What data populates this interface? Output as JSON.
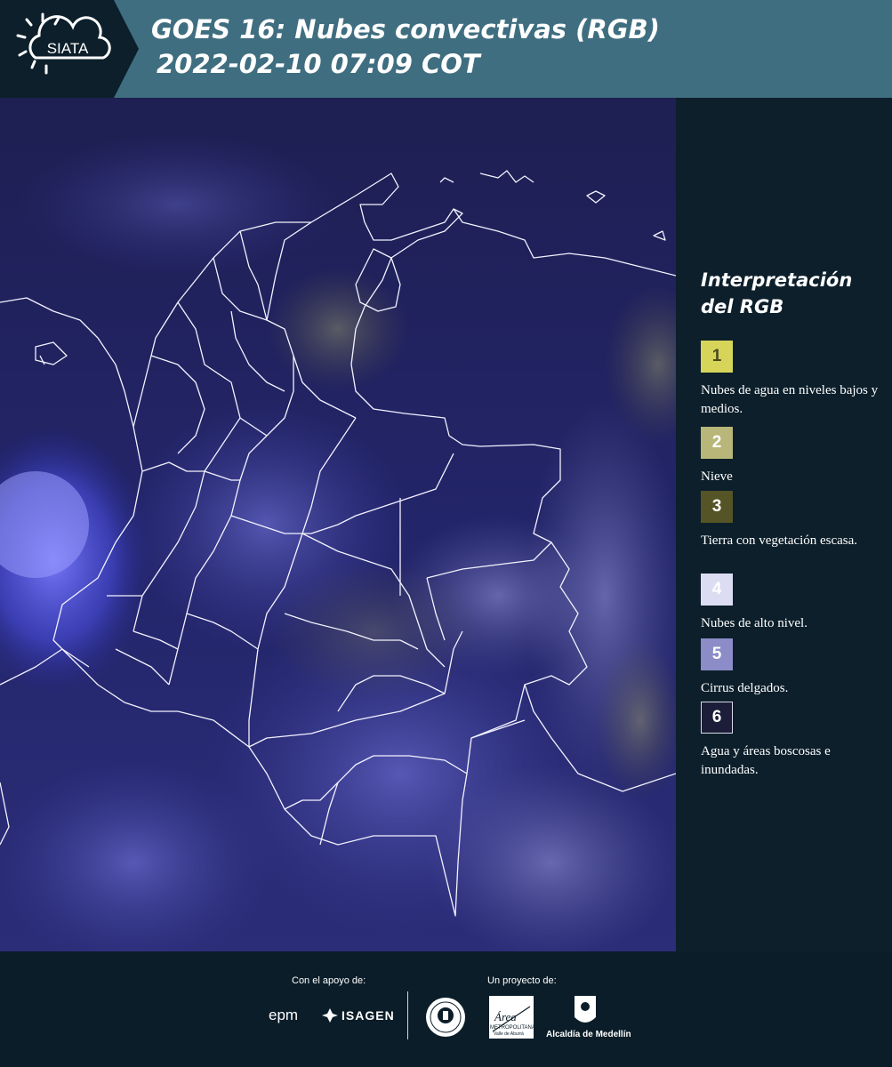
{
  "header": {
    "logo_text": "SIATA",
    "title_line1": "GOES 16: Nubes convectivas (RGB)",
    "title_line2": "2022-02-10 07:09 COT"
  },
  "legend": {
    "title": "Interpretación del RGB",
    "items": [
      {
        "number": "1",
        "label": "Nubes de agua en niveles bajos y medios.",
        "color": "#d6d55a",
        "text_color": "#4a4a20"
      },
      {
        "number": "2",
        "label": "Nieve",
        "color": "#b9b679",
        "text_color": "#ffffff"
      },
      {
        "number": "3",
        "label": "Tierra con vegetación escasa.",
        "color": "#545426",
        "text_color": "#ffffff"
      },
      {
        "number": "4",
        "label": "Nubes de alto nivel.",
        "color": "#dcdcf2",
        "text_color": "#ffffff"
      },
      {
        "number": "5",
        "label": "Cirrus delgados.",
        "color": "#8c8cc8",
        "text_color": "#ffffff"
      },
      {
        "number": "6",
        "label": "Agua y áreas boscosas e inundadas.",
        "color": "#1c1d38",
        "text_color": "#ffffff"
      }
    ]
  },
  "footer": {
    "support_label": "Con el apoyo de:",
    "project_label": "Un proyecto de:",
    "epm_text": "epm",
    "isagen_text": "ISAGEN",
    "area_text": "Área",
    "area_sub1": "METROPOLITANA",
    "area_sub2": "Valle de Aburrá",
    "alcaldia_text": "Alcaldía de Medellín"
  }
}
